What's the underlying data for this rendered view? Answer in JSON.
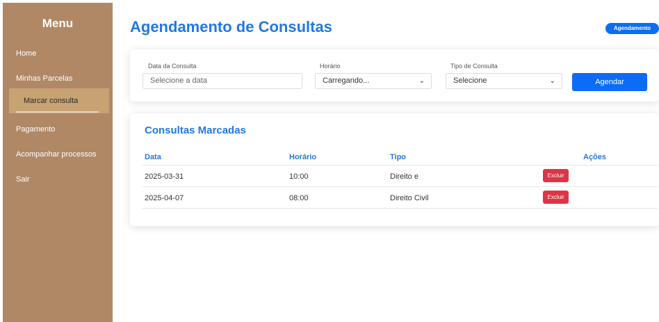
{
  "sidebar": {
    "title": "Menu",
    "items": [
      {
        "label": "Home"
      },
      {
        "label": "Minhas Parcelas"
      },
      {
        "label": "Marcar consulta"
      },
      {
        "label": "Pagamento"
      },
      {
        "label": "Acompanhar processos"
      },
      {
        "label": "Sair"
      }
    ]
  },
  "header": {
    "title": "Agendamento de Consultas",
    "badge": "Agendamento"
  },
  "form": {
    "date": {
      "label": "Data da Consulta",
      "placeholder": "Selecione a data"
    },
    "time": {
      "label": "Horário",
      "value": "Carregando..."
    },
    "type": {
      "label": "Tipo de Consulta",
      "value": "Selecione"
    },
    "submit_label": "Agendar"
  },
  "appointments": {
    "title": "Consultas Marcadas",
    "columns": [
      "Data",
      "Horário",
      "Tipo",
      "Ações"
    ],
    "rows": [
      {
        "date": "2025-03-31",
        "time": "10:00",
        "type": "Direito e",
        "action": "Excluir"
      },
      {
        "date": "2025-04-07",
        "time": "08:00",
        "type": "Direito Civil",
        "action": "Excluir"
      }
    ]
  },
  "colors": {
    "sidebar": "#b08866",
    "sidebar_active": "#c7a273",
    "accent": "#1f78e6",
    "primary_button": "#0b6cf5",
    "danger": "#dc3545"
  },
  "icons": {
    "select_chevron": "chevron-down-icon"
  }
}
